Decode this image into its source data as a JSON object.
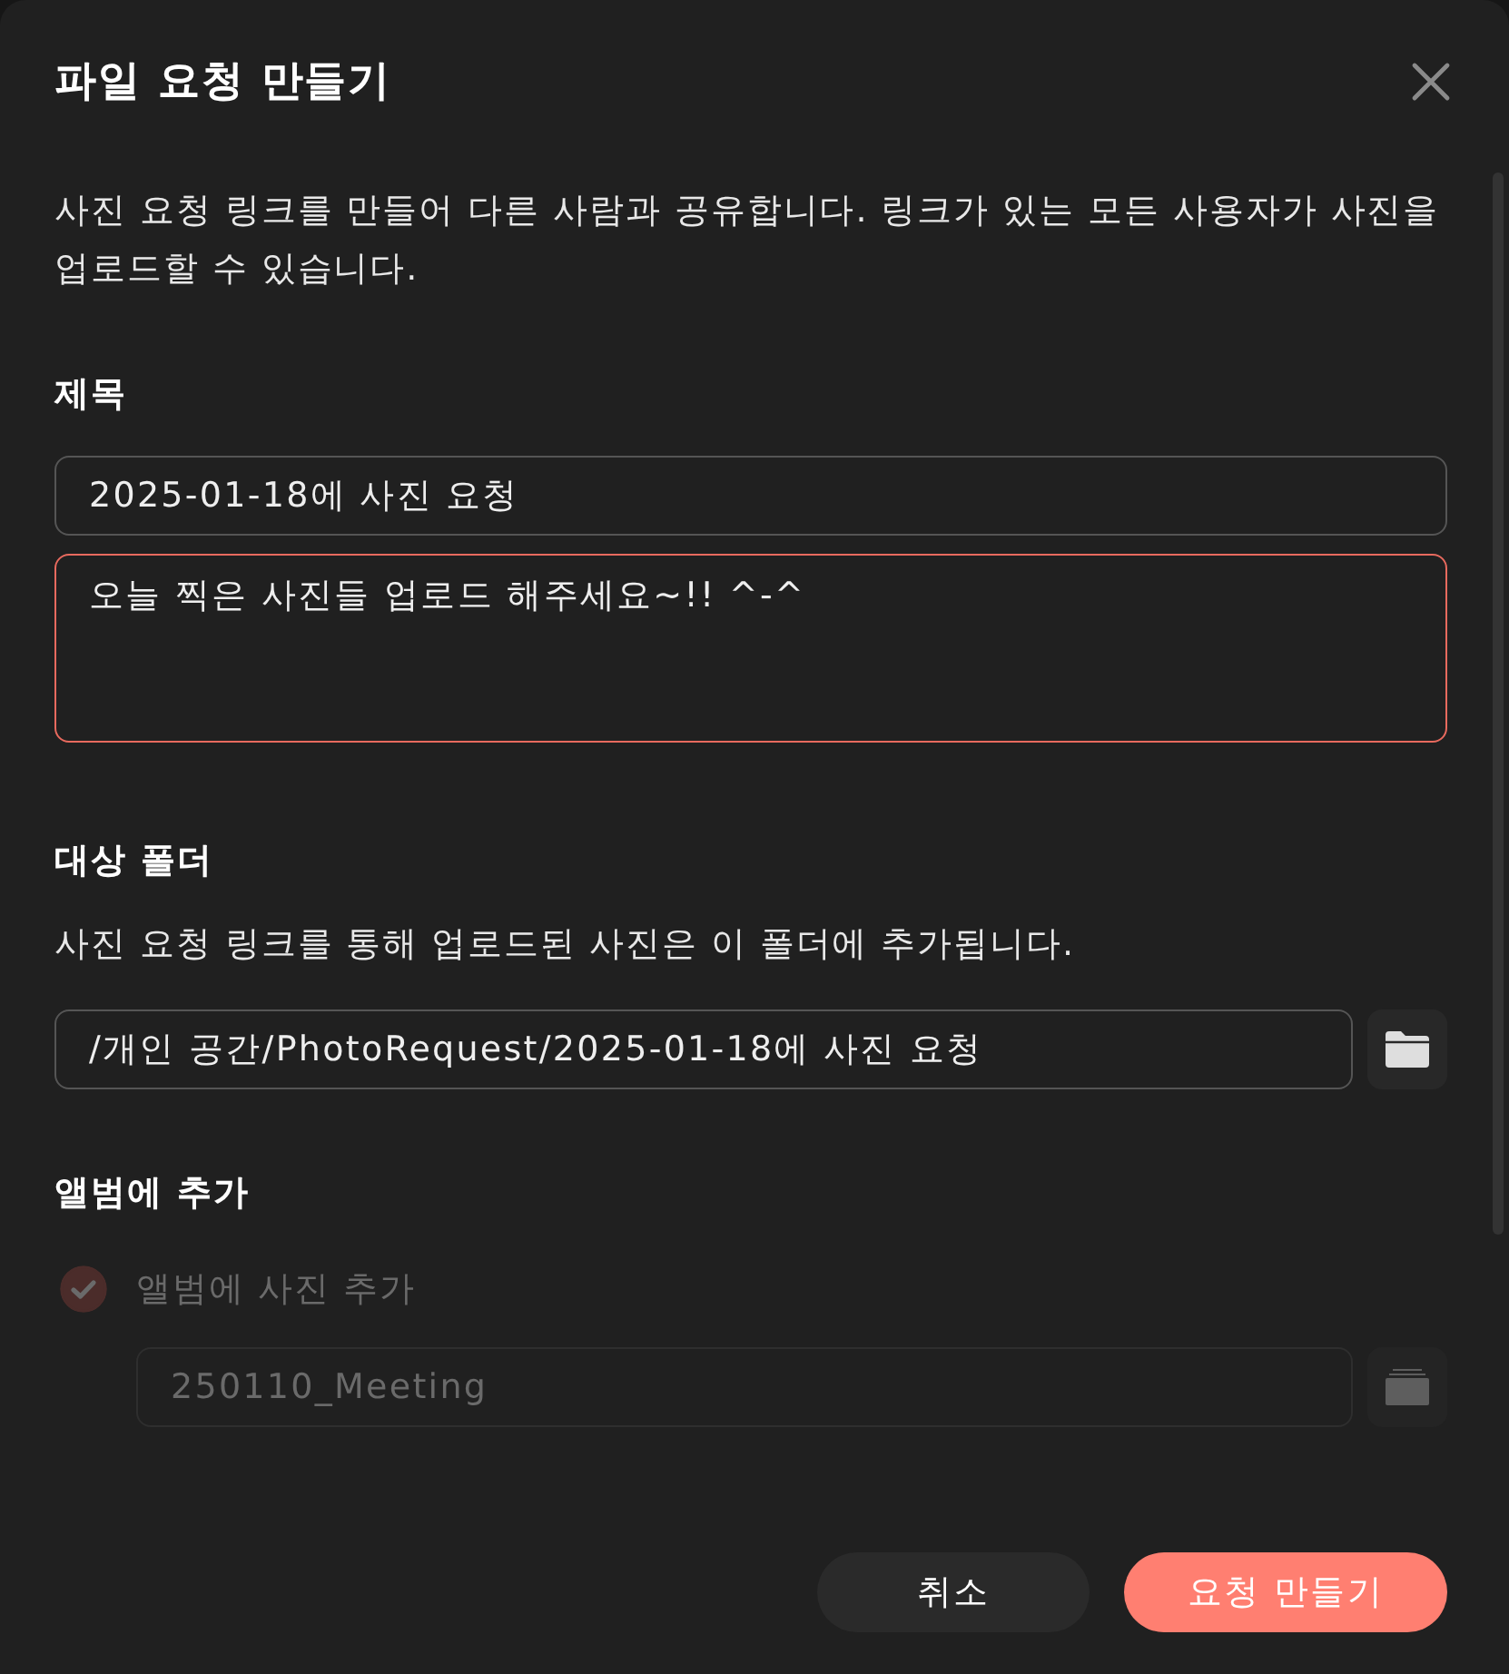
{
  "dialog": {
    "title": "파일 요청 만들기",
    "description": "사진 요청 링크를 만들어 다른 사람과 공유합니다. 링크가 있는 모든 사용자가 사진을 업로드할 수 있습니다."
  },
  "title_section": {
    "heading": "제목",
    "title_field": {
      "value": "2025-01-18에 사진 요청"
    },
    "message_field": {
      "value": "오늘 찍은 사진들 업로드 해주세요~!! ^-^",
      "focused": true
    }
  },
  "folder_section": {
    "heading": "대상 폴더",
    "description": "사진 요청 링크를 통해 업로드된 사진은 이 폴더에 추가됩니다.",
    "path_field": {
      "value": "/개인 공간/PhotoRequest/2025-01-18에 사진 요청"
    }
  },
  "album_section": {
    "heading": "앨범에 추가",
    "option": {
      "label": "앨범에 사진 추가",
      "checked": true,
      "disabled": true
    },
    "album_field": {
      "value": "250110_Meeting",
      "disabled": true
    }
  },
  "buttons": [
    {
      "label": "취소",
      "kind": "secondary"
    },
    {
      "label": "요청 만들기",
      "kind": "primary"
    }
  ]
}
